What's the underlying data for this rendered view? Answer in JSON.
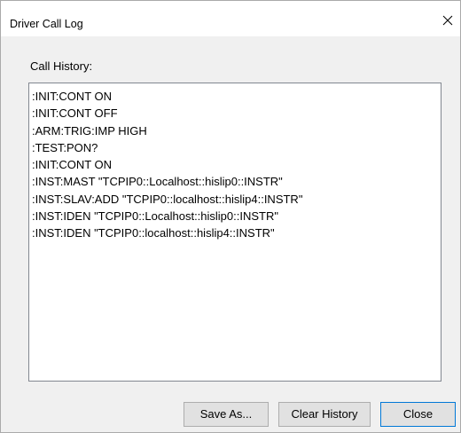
{
  "window": {
    "title": "Driver Call Log"
  },
  "history": {
    "label": "Call History:",
    "lines": [
      ":INIT:CONT ON",
      ":INIT:CONT OFF",
      ":ARM:TRIG:IMP HIGH",
      ":TEST:PON?",
      ":INIT:CONT ON",
      ":INST:MAST \"TCPIP0::Localhost::hislip0::INSTR\"",
      ":INST:SLAV:ADD \"TCPIP0::localhost::hislip4::INSTR\"",
      ":INST:IDEN \"TCPIP0::Localhost::hislip0::INSTR\"",
      ":INST:IDEN \"TCPIP0::localhost::hislip4::INSTR\""
    ]
  },
  "buttons": {
    "save_as": "Save As...",
    "clear_history": "Clear History",
    "close": "Close"
  },
  "icons": {
    "close": "close-icon"
  },
  "colors": {
    "default_button_border": "#0078d7",
    "dialog_background": "#f0f0f0"
  }
}
